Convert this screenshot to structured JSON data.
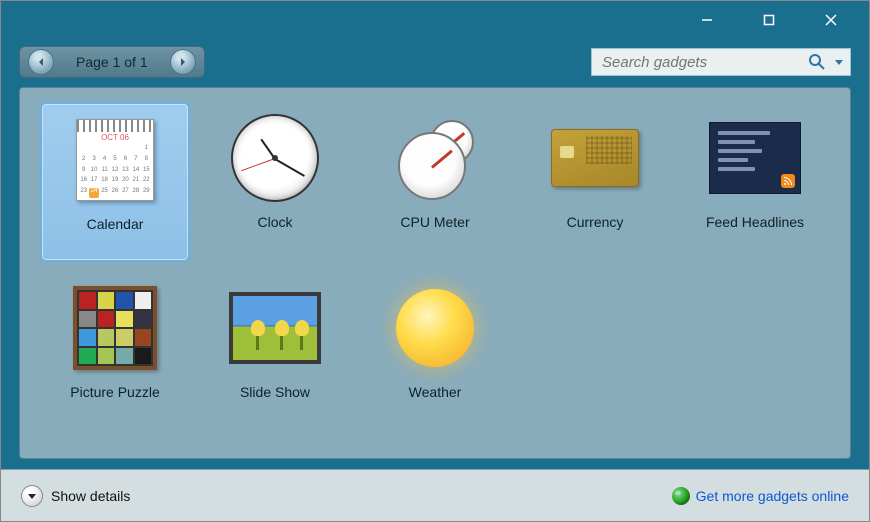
{
  "pager": {
    "label": "Page 1 of 1"
  },
  "search": {
    "placeholder": "Search gadgets"
  },
  "gadgets": {
    "g0": {
      "label": "Calendar"
    },
    "g1": {
      "label": "Clock"
    },
    "g2": {
      "label": "CPU Meter"
    },
    "g3": {
      "label": "Currency"
    },
    "g4": {
      "label": "Feed Headlines"
    },
    "g5": {
      "label": "Picture Puzzle"
    },
    "g6": {
      "label": "Slide Show"
    },
    "g7": {
      "label": "Weather"
    }
  },
  "calendar_preview": {
    "month": "OCT 06"
  },
  "selected_gadget_index": 0,
  "footer": {
    "show_details": "Show details",
    "more_link": "Get more gadgets online"
  }
}
